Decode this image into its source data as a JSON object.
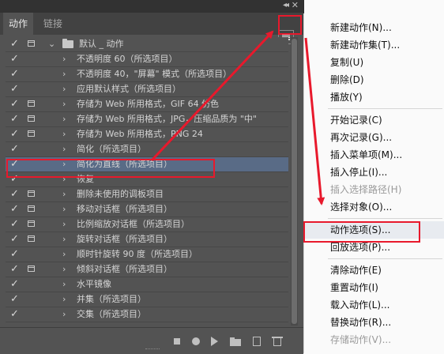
{
  "panel": {
    "collapse_glyph": "◂◂",
    "close_glyph": "✕",
    "tabs": [
      {
        "label": "动作",
        "active": true
      },
      {
        "label": "链接",
        "active": false
      }
    ]
  },
  "actions": [
    {
      "label": "默认 _ 动作",
      "checked": true,
      "dialog": true,
      "folder": true,
      "expanded": true
    },
    {
      "label": "不透明度 60（所选项目）",
      "checked": true,
      "dialog": false
    },
    {
      "label": "不透明度 40，\"屏幕\" 模式（所选项目）",
      "checked": true,
      "dialog": false
    },
    {
      "label": "应用默认样式（所选项目）",
      "checked": true,
      "dialog": false
    },
    {
      "label": "存储为 Web 所用格式，GIF 64 仿色",
      "checked": true,
      "dialog": true
    },
    {
      "label": "存储为 Web 所用格式，JPG，压缩品质为 \"中\"",
      "checked": true,
      "dialog": true
    },
    {
      "label": "存储为 Web 所用格式，PNG 24",
      "checked": true,
      "dialog": true
    },
    {
      "label": "简化（所选项目）",
      "checked": true,
      "dialog": false
    },
    {
      "label": "简化为直线（所选项目）",
      "checked": true,
      "dialog": false,
      "selected": true
    },
    {
      "label": "恢复",
      "checked": true,
      "dialog": false
    },
    {
      "label": "删除未使用的调板项目",
      "checked": true,
      "dialog": true
    },
    {
      "label": "移动对话框（所选项目）",
      "checked": true,
      "dialog": true
    },
    {
      "label": "比例缩放对话框（所选项目）",
      "checked": true,
      "dialog": true
    },
    {
      "label": "旋转对话框（所选项目）",
      "checked": true,
      "dialog": true
    },
    {
      "label": "顺时针旋转 90 度（所选项目）",
      "checked": true,
      "dialog": false
    },
    {
      "label": "倾斜对话框（所选项目）",
      "checked": true,
      "dialog": true
    },
    {
      "label": "水平镜像",
      "checked": true,
      "dialog": false
    },
    {
      "label": "并集（所选项目）",
      "checked": true,
      "dialog": false
    },
    {
      "label": "交集（所选项目）",
      "checked": true,
      "dialog": false
    }
  ],
  "toolbar_icons": [
    "stop-icon",
    "record-icon",
    "play-icon",
    "new-set-icon",
    "new-action-icon",
    "delete-icon"
  ],
  "menu": {
    "groups": [
      [
        {
          "label": "新建动作(N)...",
          "enabled": true
        },
        {
          "label": "新建动作集(T)...",
          "enabled": true
        },
        {
          "label": "复制(U)",
          "enabled": true
        },
        {
          "label": "删除(D)",
          "enabled": true
        },
        {
          "label": "播放(Y)",
          "enabled": true
        }
      ],
      [
        {
          "label": "开始记录(C)",
          "enabled": true
        },
        {
          "label": "再次记录(G)...",
          "enabled": true
        },
        {
          "label": "插入菜单项(M)...",
          "enabled": true
        },
        {
          "label": "插入停止(I)...",
          "enabled": true
        },
        {
          "label": "插入选择路径(H)",
          "enabled": false
        },
        {
          "label": "选择对象(O)...",
          "enabled": true
        }
      ],
      [
        {
          "label": "动作选项(S)...",
          "enabled": true,
          "highlighted": true
        },
        {
          "label": "回放选项(P)...",
          "enabled": true
        }
      ],
      [
        {
          "label": "清除动作(E)",
          "enabled": true
        },
        {
          "label": "重置动作(I)",
          "enabled": true
        },
        {
          "label": "载入动作(L)...",
          "enabled": true
        },
        {
          "label": "替换动作(R)...",
          "enabled": true
        },
        {
          "label": "存储动作(V)...",
          "enabled": false
        }
      ]
    ]
  },
  "colors": {
    "panel_bg": "#535353",
    "selected_row": "#596b86",
    "annotation_red": "#e8192c",
    "menu_bg": "#fafafa"
  }
}
